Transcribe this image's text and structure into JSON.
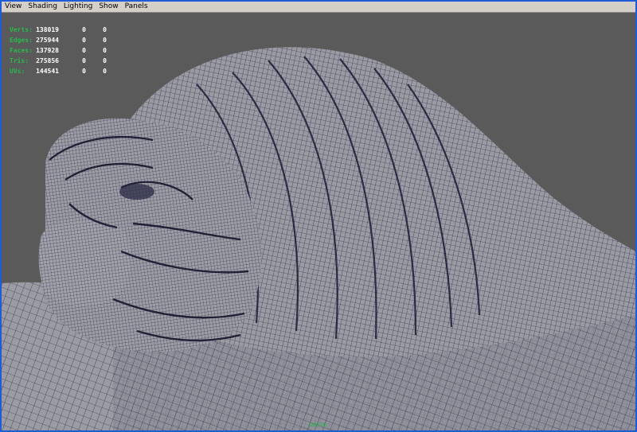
{
  "menu": {
    "items": [
      "View",
      "Shading",
      "Lighting",
      "Show",
      "Panels"
    ]
  },
  "hud": {
    "rows": [
      {
        "label": "Verts:",
        "v1": "138019",
        "v2": "0",
        "v3": "0"
      },
      {
        "label": "Edges:",
        "v1": "275944",
        "v2": "0",
        "v3": "0"
      },
      {
        "label": "Faces:",
        "v1": "137928",
        "v2": "0",
        "v3": "0"
      },
      {
        "label": "Tris:",
        "v1": "275856",
        "v2": "0",
        "v3": "0"
      },
      {
        "label": "UVs:",
        "v1": "144541",
        "v2": "0",
        "v3": "0"
      }
    ]
  },
  "viewport": {
    "camera_label": "persp",
    "colors": {
      "background": "#5a5a5a",
      "surface": "#9a9aa3",
      "wire": "#1c1c3a",
      "hud_label": "#29b84a",
      "window_border": "#1f5bd6"
    }
  }
}
